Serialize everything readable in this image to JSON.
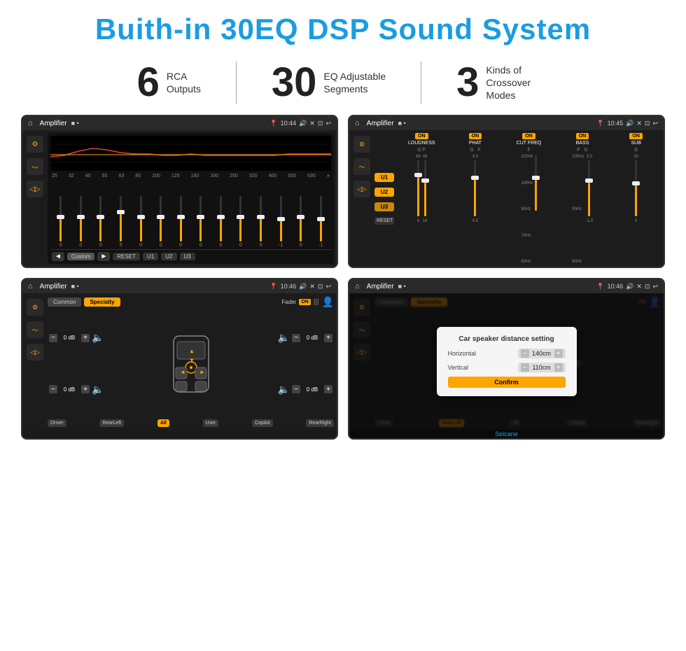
{
  "header": {
    "title": "Buith-in 30EQ DSP Sound System"
  },
  "stats": [
    {
      "number": "6",
      "label": "RCA\nOutputs"
    },
    {
      "number": "30",
      "label": "EQ Adjustable\nSegments"
    },
    {
      "number": "3",
      "label": "Kinds of\nCrossover Modes"
    }
  ],
  "screen1": {
    "title": "Amplifier",
    "time": "10:44",
    "freqs": [
      "25",
      "32",
      "40",
      "50",
      "63",
      "80",
      "100",
      "125",
      "160",
      "200",
      "250",
      "320",
      "400",
      "500",
      "630"
    ],
    "values": [
      "0",
      "0",
      "0",
      "5",
      "0",
      "0",
      "0",
      "0",
      "0",
      "0",
      "0",
      "-1",
      "0",
      "-1"
    ],
    "bottomBtns": [
      "Custom",
      "RESET",
      "U1",
      "U2",
      "U3"
    ]
  },
  "screen2": {
    "title": "Amplifier",
    "time": "10:45",
    "channels": [
      "LOUDNESS",
      "PHAT",
      "CUT FREQ",
      "BASS",
      "SUB"
    ],
    "uLabels": [
      "U1",
      "U2",
      "U3"
    ],
    "resetBtn": "RESET"
  },
  "screen3": {
    "title": "Amplifier",
    "time": "10:46",
    "tabs": [
      "Common",
      "Specialty"
    ],
    "faderLabel": "Fader",
    "positions": [
      "Driver",
      "RearLeft",
      "All",
      "User",
      "Copilot",
      "RearRight"
    ],
    "dbValues": [
      "0 dB",
      "0 dB",
      "0 dB",
      "0 dB"
    ]
  },
  "screen4": {
    "title": "Amplifier",
    "time": "10:46",
    "tabs": [
      "Common",
      "Specialty"
    ],
    "dialog": {
      "title": "Car speaker distance setting",
      "fields": [
        {
          "label": "Horizontal",
          "value": "140cm"
        },
        {
          "label": "Vertical",
          "value": "110cm"
        }
      ],
      "confirmBtn": "Confirm"
    },
    "positions": [
      "Driver",
      "RearLeft",
      "All",
      "Copilot",
      "RearRight"
    ],
    "dbValues": [
      "0 dB",
      "0 dB"
    ]
  },
  "watermark": "Seicane"
}
